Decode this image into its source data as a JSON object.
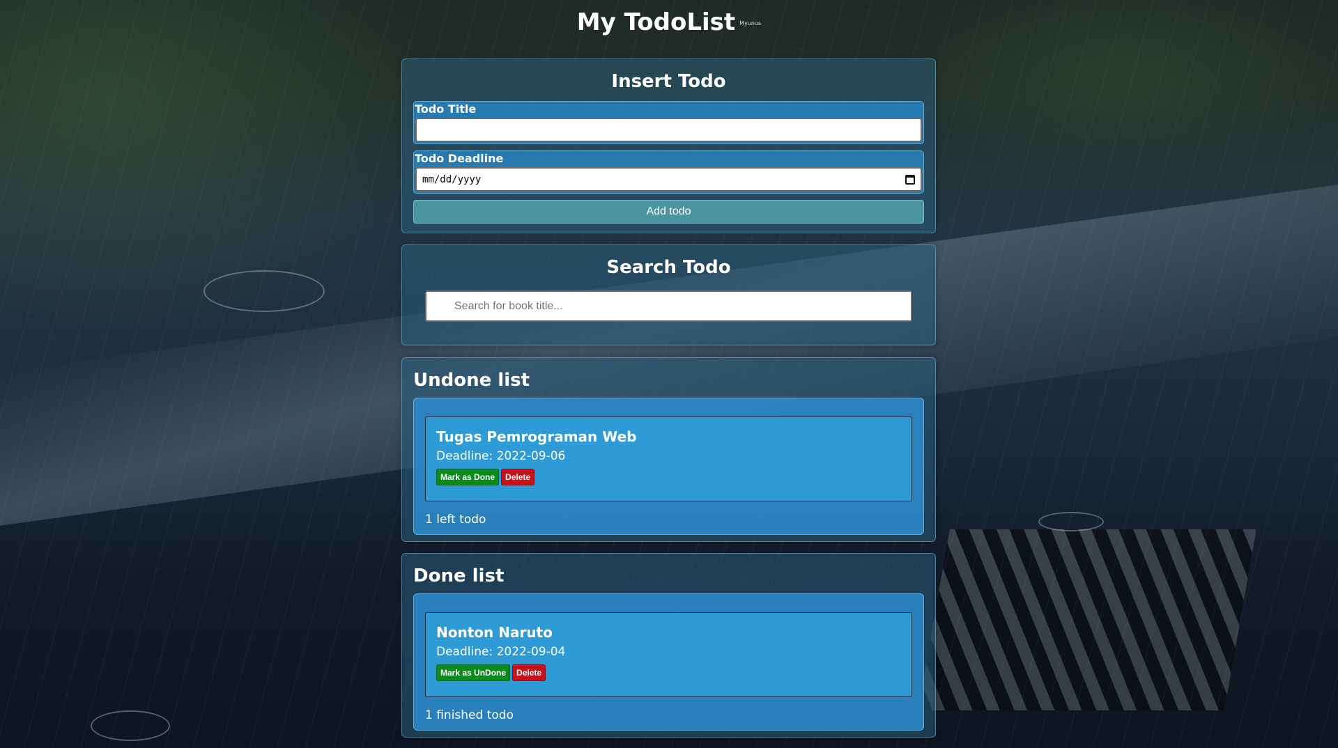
{
  "app": {
    "title": "My TodoList",
    "credit": "Myunus"
  },
  "insert": {
    "heading": "Insert Todo",
    "title_label": "Todo Title",
    "title_value": "",
    "deadline_label": "Todo Deadline",
    "deadline_placeholder": "mm/dd/yyyy",
    "add_label": "Add todo"
  },
  "search": {
    "heading": "Search Todo",
    "placeholder": "Search for book title..."
  },
  "undone": {
    "heading": "Undone list",
    "items": [
      {
        "title": "Tugas Pemrograman Web",
        "deadline": "Deadline: 2022-09-06",
        "primary_action": "Mark as Done",
        "delete": "Delete"
      }
    ],
    "count_text": "1 left todo"
  },
  "done": {
    "heading": "Done list",
    "items": [
      {
        "title": "Nonton Naruto",
        "deadline": "Deadline: 2022-09-04",
        "primary_action": "Mark as UnDone",
        "delete": "Delete"
      }
    ],
    "count_text": "1 finished todo"
  },
  "colors": {
    "done_button": "#0b8a1d",
    "delete_button": "#c8121a",
    "todo_card": "#2e9ad6",
    "add_button": "#4a95a0"
  },
  "icons": {
    "deadline_picker": "calendar-icon"
  }
}
